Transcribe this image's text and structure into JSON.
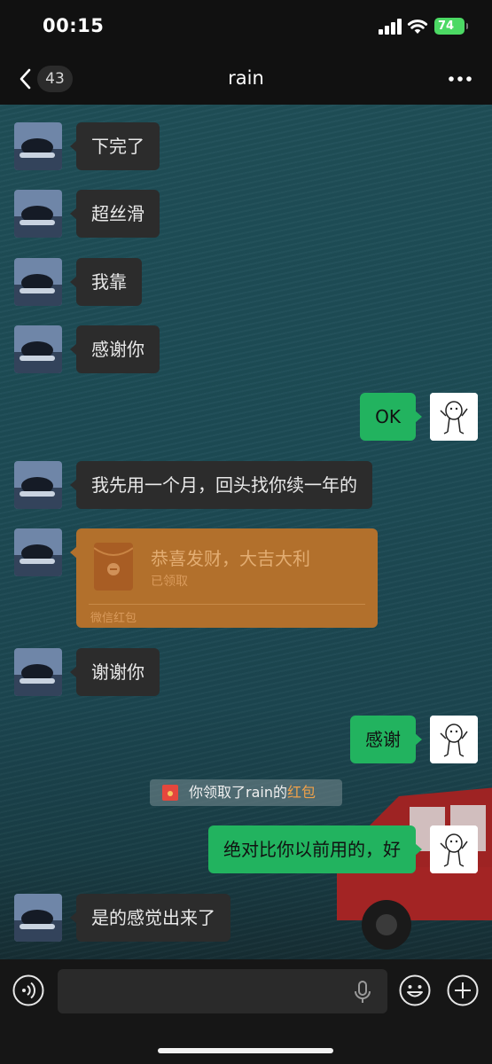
{
  "status_bar": {
    "time": "00:15",
    "battery": "74",
    "battery_color": "#4cd964"
  },
  "nav": {
    "unread_count": "43",
    "title": "rain",
    "icons": [
      "chevron-left-icon",
      "more-icon"
    ]
  },
  "messages": [
    {
      "side": "left",
      "type": "text",
      "text": "下完了"
    },
    {
      "side": "left",
      "type": "text",
      "text": "超丝滑"
    },
    {
      "side": "left",
      "type": "text",
      "text": "我靠"
    },
    {
      "side": "left",
      "type": "text",
      "text": "感谢你"
    },
    {
      "side": "right",
      "type": "text",
      "text": "OK"
    },
    {
      "side": "left",
      "type": "text",
      "text": "我先用一个月，回头找你续一年的"
    },
    {
      "side": "left",
      "type": "red_packet",
      "title": "恭喜发财，大吉大利",
      "status": "已领取",
      "footer": "微信红包"
    },
    {
      "side": "left",
      "type": "text",
      "text": "谢谢你"
    },
    {
      "side": "right",
      "type": "text",
      "text": "感谢"
    },
    {
      "side": "system",
      "type": "notice",
      "text": "你领取了rain的",
      "link": "红包"
    },
    {
      "side": "right",
      "type": "text",
      "text": "绝对比你以前用的，好"
    },
    {
      "side": "left",
      "type": "text",
      "text": "是的感觉出来了"
    }
  ],
  "colors": {
    "bubble_left": "#2c2c2c",
    "bubble_right": "#22b35f",
    "red_packet": "#b2702c",
    "chat_background": "#1f4e57"
  },
  "input_bar": {
    "icons": [
      "voice-icon",
      "mic-icon",
      "emoji-icon",
      "plus-icon"
    ]
  }
}
